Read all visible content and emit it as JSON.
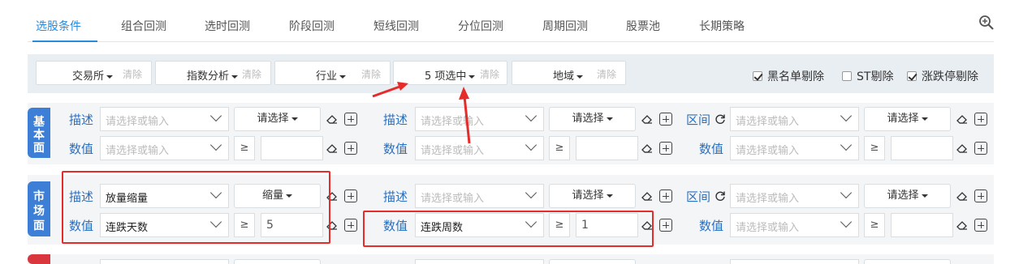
{
  "tabs": [
    {
      "label": "选股条件",
      "active": true
    },
    {
      "label": "组合回测"
    },
    {
      "label": "选时回测"
    },
    {
      "label": "阶段回测"
    },
    {
      "label": "短线回测"
    },
    {
      "label": "分位回测"
    },
    {
      "label": "周期回测"
    },
    {
      "label": "股票池"
    },
    {
      "label": "长期策略"
    }
  ],
  "filters": {
    "exchange": {
      "label": "交易所",
      "clear": "清除"
    },
    "index": {
      "label": "指数分析",
      "clear": "清除"
    },
    "industry": {
      "label": "行业",
      "clear": "清除"
    },
    "selected": {
      "label": "5 项选中",
      "clear": "清除"
    },
    "region": {
      "label": "地域",
      "clear": "清除"
    },
    "checks": [
      {
        "label": "黑名单剔除",
        "checked": true
      },
      {
        "label": "ST剔除",
        "checked": false
      },
      {
        "label": "涨跌停剔除",
        "checked": true
      }
    ]
  },
  "common": {
    "desc": "描述",
    "value": "数值",
    "range": "区间",
    "placeholder": "请选择或输入",
    "choose": "请选择",
    "ge": "≥"
  },
  "sections": {
    "basic": {
      "tag": "基本面",
      "color": "#3d7fd6"
    },
    "market": {
      "tag": "市场面",
      "color": "#3d7fd6",
      "desc1": "放量缩量",
      "sel1": "缩量",
      "value1": "连跌天数",
      "num1": "5",
      "value2": "连跌周数",
      "num2": "1"
    },
    "third": {
      "color": "#d9363e"
    }
  },
  "colors": {
    "accent": "#2b8ad9",
    "highlight": "#e62b2b"
  }
}
